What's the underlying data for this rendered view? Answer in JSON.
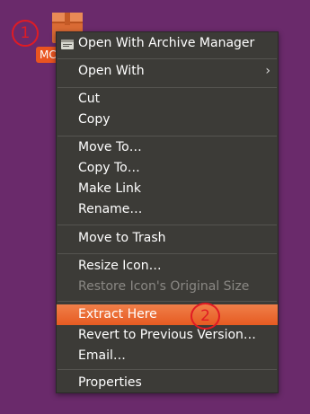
{
  "colors": {
    "desktop_background": "#6a2a6b",
    "menu_background": "#3c3b37",
    "highlight": "#e95420",
    "badge": "#e01b24"
  },
  "desktop": {
    "file_icon": "archive-box-icon",
    "file_label": "MC"
  },
  "badges": [
    "1",
    "2"
  ],
  "context_menu": {
    "items": [
      {
        "label": "Open With Archive Manager",
        "icon": "archive-manager-icon",
        "enabled": true
      },
      {
        "label": "Open With",
        "submenu": true,
        "enabled": true
      },
      {
        "label": "Cut",
        "enabled": true
      },
      {
        "label": "Copy",
        "enabled": true
      },
      {
        "label": "Move To…",
        "enabled": true
      },
      {
        "label": "Copy To…",
        "enabled": true
      },
      {
        "label": "Make Link",
        "enabled": true
      },
      {
        "label": "Rename…",
        "enabled": true
      },
      {
        "label": "Move to Trash",
        "enabled": true
      },
      {
        "label": "Resize Icon…",
        "enabled": true
      },
      {
        "label": "Restore Icon's Original Size",
        "enabled": false
      },
      {
        "label": "Extract Here",
        "enabled": true,
        "highlighted": true
      },
      {
        "label": "Revert to Previous Version…",
        "enabled": true
      },
      {
        "label": "Email…",
        "enabled": true
      },
      {
        "label": "Properties",
        "enabled": true
      }
    ]
  }
}
